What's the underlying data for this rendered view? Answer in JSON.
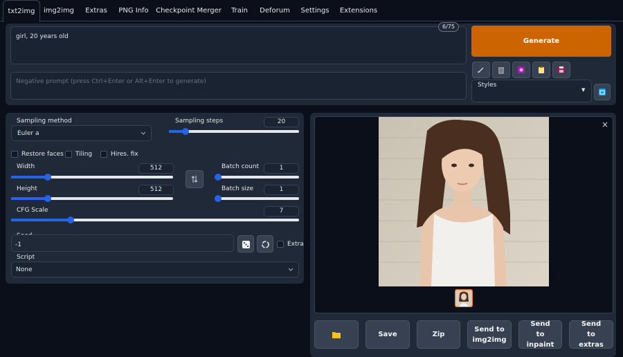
{
  "tabs": [
    "txt2img",
    "img2img",
    "Extras",
    "PNG Info",
    "Checkpoint Merger",
    "Train",
    "Deforum",
    "Settings",
    "Extensions"
  ],
  "prompt": {
    "value": "girl, 20 years old",
    "token_count": "6/75"
  },
  "negative_prompt": {
    "placeholder": "Negative prompt (press Ctrl+Enter or Alt+Enter to generate)"
  },
  "generate_label": "Generate",
  "styles_label": "Styles",
  "tool_icons": [
    "pencil-icon",
    "trash-icon",
    "image-icon",
    "clipboard-icon",
    "save-icon"
  ],
  "sampling": {
    "method_label": "Sampling method",
    "method_value": "Euler a",
    "steps_label": "Sampling steps",
    "steps_value": "20",
    "steps_min": 1,
    "steps_max": 150
  },
  "checkboxes": {
    "restore_faces": "Restore faces",
    "tiling": "Tiling",
    "hires_fix": "Hires. fix"
  },
  "width": {
    "label": "Width",
    "value": "512",
    "min": 64,
    "max": 2048
  },
  "height": {
    "label": "Height",
    "value": "512",
    "min": 64,
    "max": 2048
  },
  "batch_count": {
    "label": "Batch count",
    "value": "1",
    "min": 1,
    "max": 100
  },
  "batch_size": {
    "label": "Batch size",
    "value": "1",
    "min": 1,
    "max": 8
  },
  "cfg": {
    "label": "CFG Scale",
    "value": "7",
    "min": 1,
    "max": 30
  },
  "seed": {
    "label": "Seed",
    "value": "-1",
    "extra_label": "Extra"
  },
  "script": {
    "label": "Script",
    "value": "None"
  },
  "output": {
    "close_glyph": "×",
    "buttons": {
      "folder": "folder-icon",
      "save": "Save",
      "zip": "Zip",
      "img2img": "Send to img2img",
      "inpaint": "Send to inpaint",
      "extras": "Send to extras"
    }
  },
  "colors": {
    "accent": "#cc6400",
    "slider": "#2563eb",
    "background": "#0b0f19",
    "panel": "#1f2937"
  }
}
